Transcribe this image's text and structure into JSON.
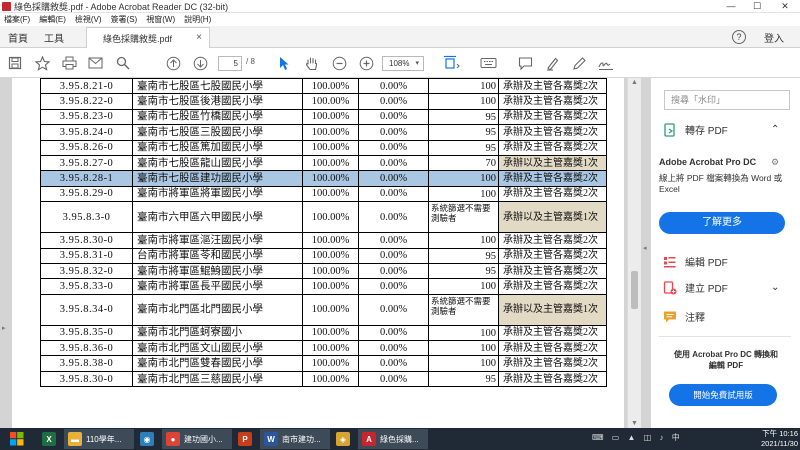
{
  "window": {
    "title": "綠色採購敘獎.pdf - Adobe Acrobat Reader DC (32-bit)",
    "minimize": "—",
    "maximize": "☐",
    "close": "✕"
  },
  "menu": [
    "檔案(F)",
    "編輯(E)",
    "檢視(V)",
    "簽署(S)",
    "視窗(W)",
    "說明(H)"
  ],
  "tabs": {
    "home": "首頁",
    "tools": "工具",
    "document": "綠色採購敘獎.pdf",
    "help": "?",
    "login": "登入"
  },
  "toolbar": {
    "page_current": "5",
    "page_total": "/ 8",
    "zoom": "108%"
  },
  "table": {
    "rows": [
      {
        "code": "3.95.8.21-0",
        "school": "臺南市七股區七股國民小學",
        "pct1": "100.00%",
        "pct2": "0.00%",
        "note": "",
        "score": "100",
        "award": "承辦及主管各嘉獎2次",
        "beige": false,
        "selected": false,
        "tall": false
      },
      {
        "code": "3.95.8.22-0",
        "school": "臺南市七股區後港國民小學",
        "pct1": "100.00%",
        "pct2": "0.00%",
        "note": "",
        "score": "100",
        "award": "承辦及主管各嘉獎2次",
        "beige": false,
        "selected": false,
        "tall": false
      },
      {
        "code": "3.95.8.23-0",
        "school": "臺南市七股區竹橋國民小學",
        "pct1": "100.00%",
        "pct2": "0.00%",
        "note": "",
        "score": "95",
        "award": "承辦及主管各嘉獎2次",
        "beige": false,
        "selected": false,
        "tall": false
      },
      {
        "code": "3.95.8.24-0",
        "school": "臺南市七股區三股國民小學",
        "pct1": "100.00%",
        "pct2": "0.00%",
        "note": "",
        "score": "95",
        "award": "承辦及主管各嘉獎2次",
        "beige": false,
        "selected": false,
        "tall": false
      },
      {
        "code": "3.95.8.26-0",
        "school": "臺南市七股區篤加國民小學",
        "pct1": "100.00%",
        "pct2": "0.00%",
        "note": "",
        "score": "95",
        "award": "承辦及主管各嘉獎2次",
        "beige": false,
        "selected": false,
        "tall": false
      },
      {
        "code": "3.95.8.27-0",
        "school": "臺南市七股區龍山國民小學",
        "pct1": "100.00%",
        "pct2": "0.00%",
        "note": "",
        "score": "70",
        "award": "承辦以及主管嘉獎1次",
        "beige": true,
        "selected": false,
        "tall": false
      },
      {
        "code": "3.95.8.28-1",
        "school": "臺南市七股區建功國民小學",
        "pct1": "100.00%",
        "pct2": "0.00%",
        "note": "",
        "score": "100",
        "award": "承辦及主管各嘉獎2次",
        "beige": false,
        "selected": true,
        "tall": false
      },
      {
        "code": "3.95.8.29-0",
        "school": "臺南市將軍區將軍國民小學",
        "pct1": "100.00%",
        "pct2": "0.00%",
        "note": "",
        "score": "100",
        "award": "承辦及主管各嘉獎2次",
        "beige": false,
        "selected": false,
        "tall": false
      },
      {
        "code": "3.95.8.3-0",
        "school": "臺南市六甲區六甲國民小學",
        "pct1": "100.00%",
        "pct2": "0.00%",
        "note": "系統篩選不需要測驗者",
        "score": "",
        "award": "承辦以及主管嘉獎1次",
        "beige": true,
        "selected": false,
        "tall": true
      },
      {
        "code": "3.95.8.30-0",
        "school": "臺南市將軍區漚汪國民小學",
        "pct1": "100.00%",
        "pct2": "0.00%",
        "note": "",
        "score": "100",
        "award": "承辦及主管各嘉獎2次",
        "beige": false,
        "selected": false,
        "tall": false
      },
      {
        "code": "3.95.8.31-0",
        "school": "台南市將軍區苓和國民小學",
        "pct1": "100.00%",
        "pct2": "0.00%",
        "note": "",
        "score": "95",
        "award": "承辦及主管各嘉獎2次",
        "beige": false,
        "selected": false,
        "tall": false
      },
      {
        "code": "3.95.8.32-0",
        "school": "臺南市將軍區鯤鯓國民小學",
        "pct1": "100.00%",
        "pct2": "0.00%",
        "note": "",
        "score": "95",
        "award": "承辦及主管各嘉獎2次",
        "beige": false,
        "selected": false,
        "tall": false
      },
      {
        "code": "3.95.8.33-0",
        "school": "臺南市將軍區長平國民小學",
        "pct1": "100.00%",
        "pct2": "0.00%",
        "note": "",
        "score": "100",
        "award": "承辦及主管各嘉獎2次",
        "beige": false,
        "selected": false,
        "tall": false
      },
      {
        "code": "3.95.8.34-0",
        "school": "臺南市北門區北門國民小學",
        "pct1": "100.00%",
        "pct2": "0.00%",
        "note": "系統篩選不需要測驗者",
        "score": "",
        "award": "承辦以及主管嘉獎1次",
        "beige": true,
        "selected": false,
        "tall": true
      },
      {
        "code": "3.95.8.35-0",
        "school": "臺南市北門區蚵寮國小",
        "pct1": "100.00%",
        "pct2": "0.00%",
        "note": "",
        "score": "100",
        "award": "承辦及主管各嘉獎2次",
        "beige": false,
        "selected": false,
        "tall": false
      },
      {
        "code": "3.95.8.36-0",
        "school": "臺南市北門區文山國民小學",
        "pct1": "100.00%",
        "pct2": "0.00%",
        "note": "",
        "score": "100",
        "award": "承辦及主管各嘉獎2次",
        "beige": false,
        "selected": false,
        "tall": false
      },
      {
        "code": "3.95.8.38-0",
        "school": "臺南市北門區雙春國民小學",
        "pct1": "100.00%",
        "pct2": "0.00%",
        "note": "",
        "score": "100",
        "award": "承辦及主管各嘉獎2次",
        "beige": false,
        "selected": false,
        "tall": false
      },
      {
        "code": "3.95.8.30-0",
        "school": "臺南市北門區三慈國民小學",
        "pct1": "100.00%",
        "pct2": "0.00%",
        "note": "",
        "score": "95",
        "award": "承辦及主管各嘉獎2次",
        "beige": false,
        "selected": false,
        "tall": false
      }
    ]
  },
  "right_panel": {
    "search_placeholder": "搜尋「水印」",
    "export_label": "轉存 PDF",
    "promo_title": "Adobe Acrobat Pro DC",
    "promo_desc": "線上將 PDF 檔案轉換為 Word 或 Excel",
    "learn_more": "了解更多",
    "edit_label": "編輯 PDF",
    "create_label": "建立 PDF",
    "comment_label": "注釋",
    "bottom_promo": "使用 Acrobat Pro DC 轉換和編輯 PDF",
    "trial_button": "開始免費試用版"
  },
  "taskbar": {
    "items": [
      {
        "name": "excel",
        "label": "",
        "color": "#1d6f42",
        "glyph": "X"
      },
      {
        "name": "folder",
        "label": "110學年...",
        "color": "#e8b23a",
        "glyph": "▬"
      },
      {
        "name": "network",
        "label": "",
        "color": "#2c7fb8",
        "glyph": "◉"
      },
      {
        "name": "chrome",
        "label": "建功國小...",
        "color": "#db4437",
        "glyph": "●"
      },
      {
        "name": "powerpoint",
        "label": "",
        "color": "#c43e1c",
        "glyph": "P"
      },
      {
        "name": "word",
        "label": "南市建功...",
        "color": "#2b579a",
        "glyph": "W"
      },
      {
        "name": "app",
        "label": "",
        "color": "#d8a431",
        "glyph": "◈"
      },
      {
        "name": "acrobat",
        "label": "綠色採購...",
        "color": "#c6262e",
        "glyph": "A"
      }
    ],
    "time": "下午 10:16",
    "date": "2021/11/30"
  },
  "colors": {
    "selection": "#a9c6e2",
    "beige_cell": "#e2dac5",
    "acrobat_blue": "#1473e6"
  }
}
